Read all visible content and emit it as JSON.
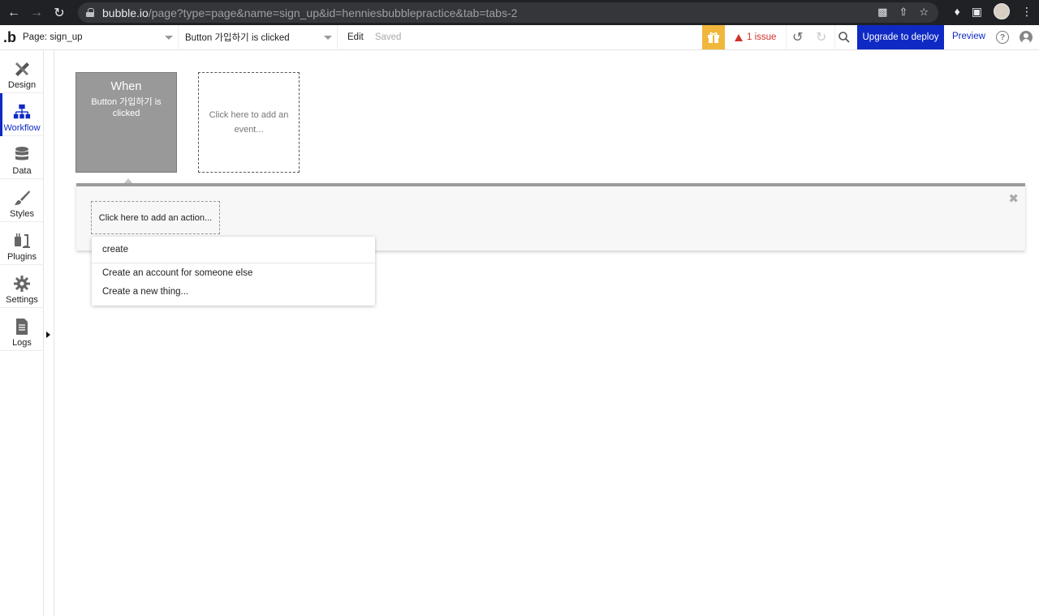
{
  "browser": {
    "url_host": "bubble.io",
    "url_path": "/page?type=page&name=sign_up&id=henniesbubblepractice&tab=tabs-2"
  },
  "toolbar": {
    "logo": ".b",
    "page_selector": "Page: sign_up",
    "event_selector": "Button 가입하기 is clicked",
    "edit_label": "Edit",
    "saved_label": "Saved",
    "issue_label": "1 issue",
    "deploy_label": "Upgrade to deploy",
    "preview_label": "Preview",
    "help_label": "?",
    "colors": {
      "deploy": "#0f2ac4",
      "gift": "#f0b73c",
      "issue": "#d0312d"
    }
  },
  "sidebar": {
    "items": [
      {
        "label": "Design",
        "icon": "design-icon"
      },
      {
        "label": "Workflow",
        "icon": "workflow-icon",
        "active": true
      },
      {
        "label": "Data",
        "icon": "database-icon"
      },
      {
        "label": "Styles",
        "icon": "brush-icon"
      },
      {
        "label": "Plugins",
        "icon": "plugin-icon"
      },
      {
        "label": "Settings",
        "icon": "gear-icon"
      },
      {
        "label": "Logs",
        "icon": "document-icon"
      }
    ]
  },
  "canvas": {
    "event_title": "When",
    "event_subtitle": "Button 가입하기 is clicked",
    "add_event_label": "Click here to add an event...",
    "add_action_label": "Click here to add an action..."
  },
  "action_search": {
    "query": "create",
    "options": [
      "Create an account for someone else",
      "Create a new thing..."
    ]
  }
}
